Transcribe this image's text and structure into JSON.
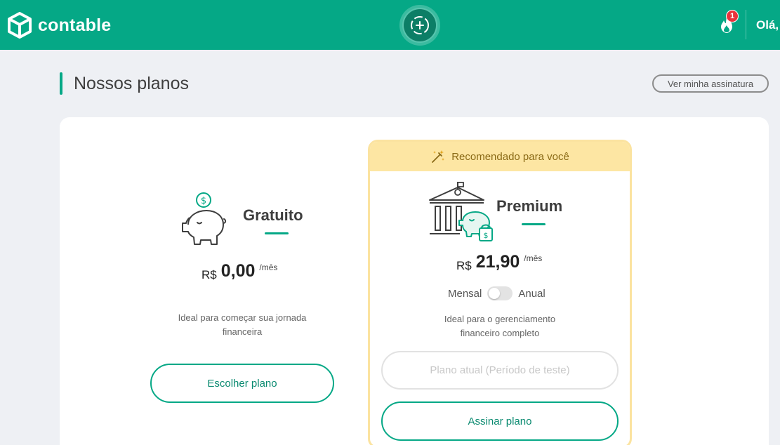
{
  "header": {
    "brand": "contable",
    "notification_count": "1",
    "greeting": "Olá,",
    "accent_color": "#05a886"
  },
  "page": {
    "title": "Nossos planos",
    "subscription_button": "Ver minha assinatura"
  },
  "plans": {
    "free": {
      "name": "Gratuito",
      "currency": "R$",
      "amount": "0,00",
      "period": "/mês",
      "description": "Ideal para começar sua jornada financeira",
      "button": "Escolher plano",
      "icon": "piggy-bank-coin-icon"
    },
    "premium": {
      "badge": "Recomendado para você",
      "badge_icon": "magic-wand-icon",
      "name": "Premium",
      "currency": "R$",
      "amount": "21,90",
      "period": "/mês",
      "billing_monthly": "Mensal",
      "billing_annual": "Anual",
      "billing_selected": "Mensal",
      "description": "Ideal para o gerenciamento financeiro completo",
      "current_plan_button": "Plano atual (Período de teste)",
      "button": "Assinar plano",
      "icon": "bank-piggy-lock-icon",
      "banner_color": "#fde6a3"
    }
  }
}
